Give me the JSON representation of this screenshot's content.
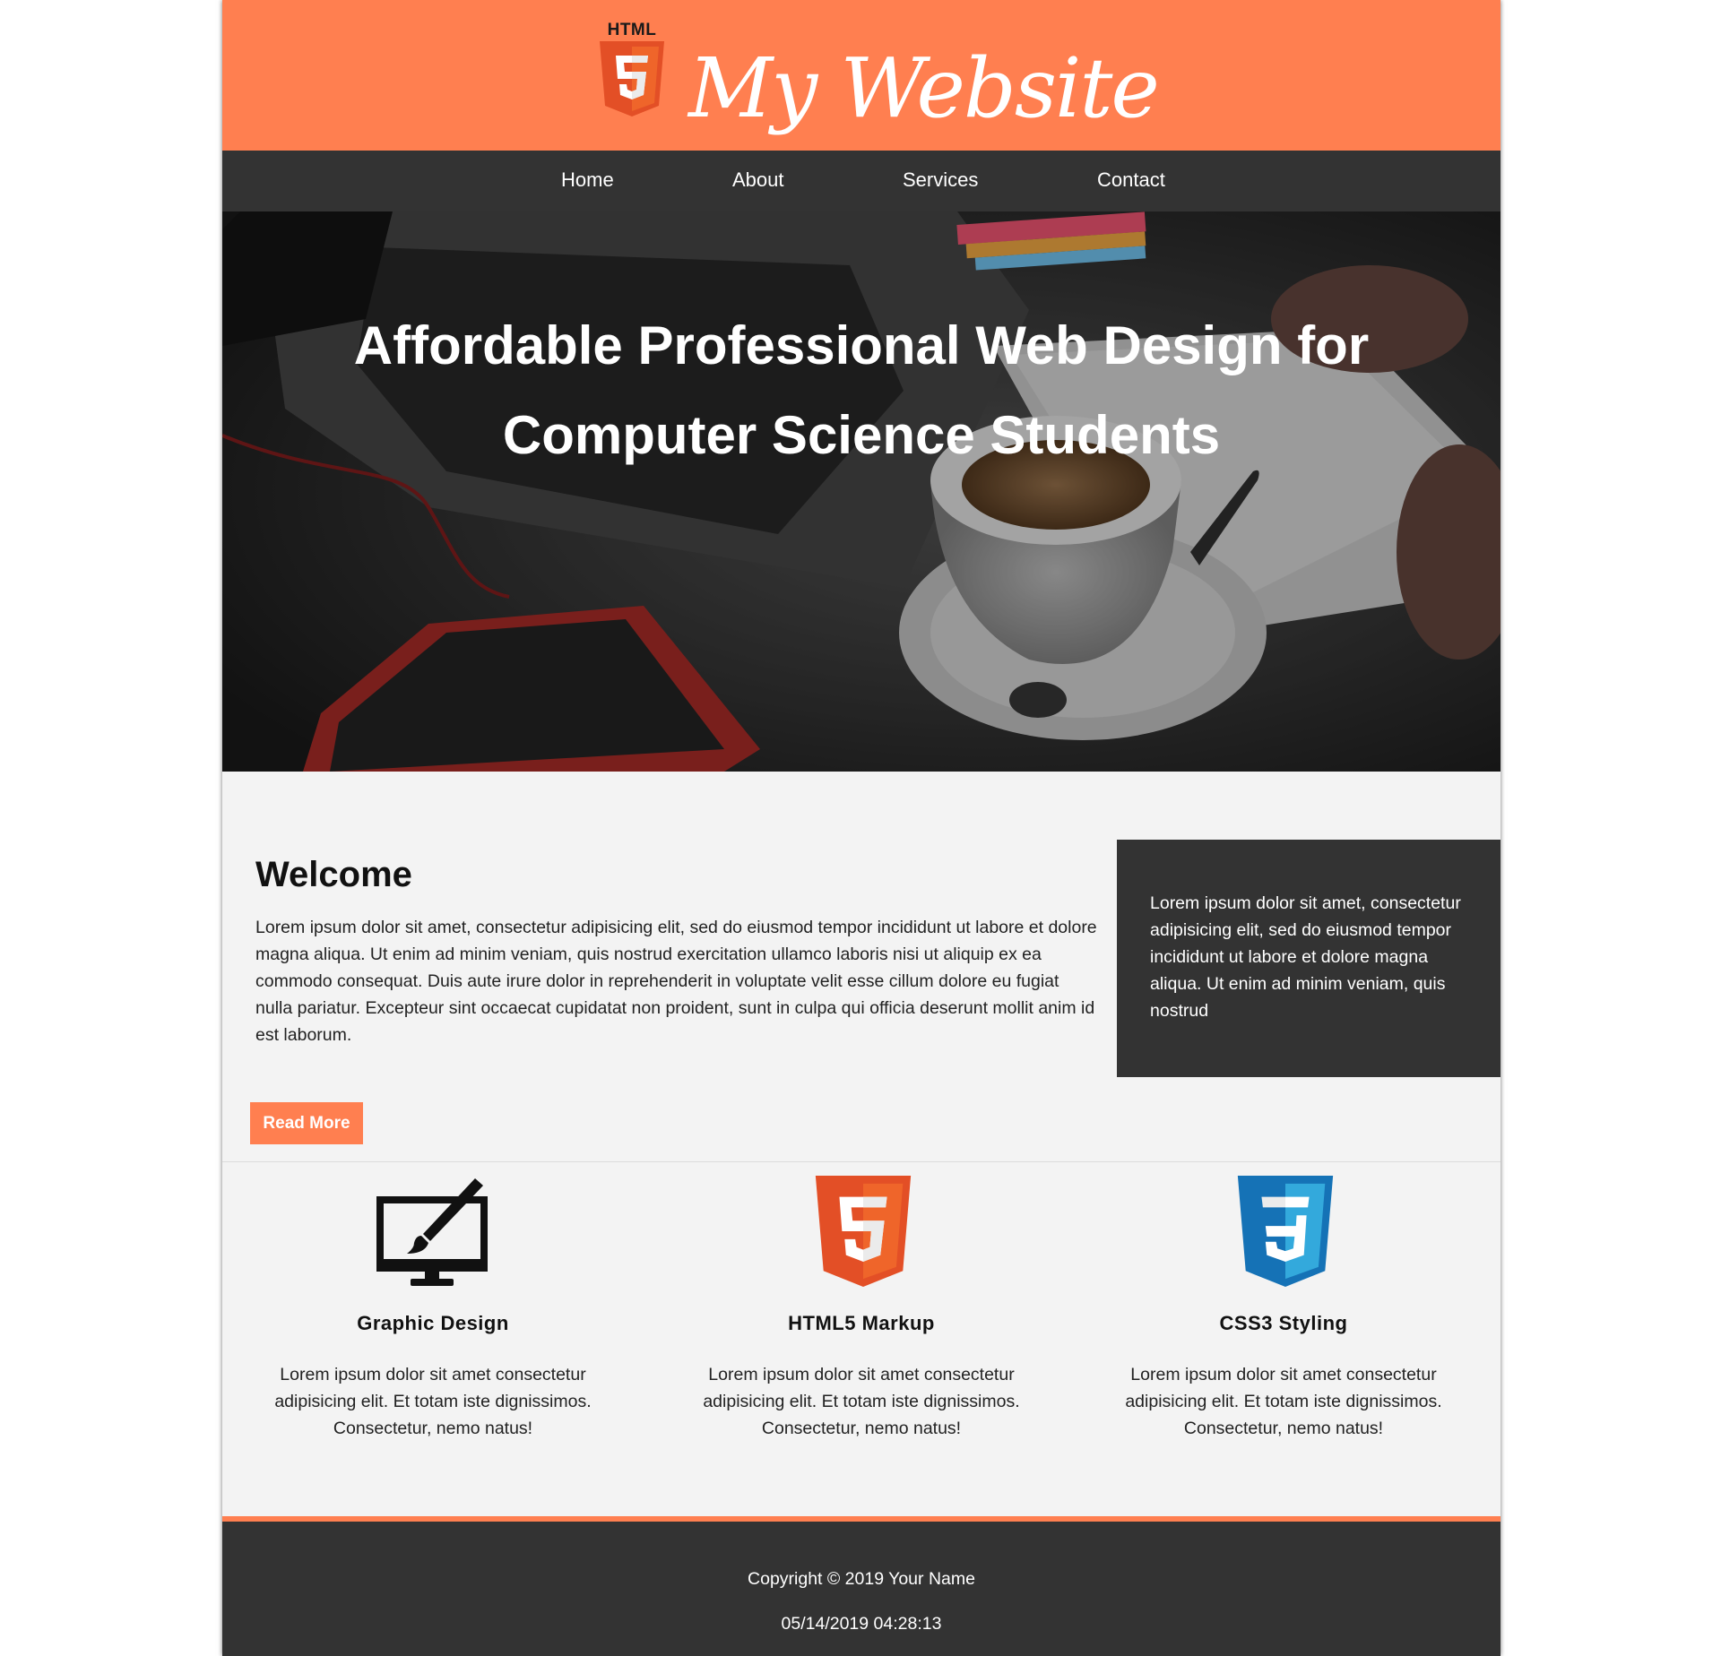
{
  "header": {
    "logo_caption": "HTML",
    "logo_digit": "5",
    "site_title": "My Website"
  },
  "nav": {
    "items": [
      {
        "label": "Home"
      },
      {
        "label": "About"
      },
      {
        "label": "Services"
      },
      {
        "label": "Contact"
      }
    ]
  },
  "hero": {
    "title_line1": "Affordable Professional Web Design for",
    "title_line2": "Computer Science Students"
  },
  "main": {
    "welcome_title": "Welcome",
    "welcome_text": "Lorem ipsum dolor sit amet, consectetur adipisicing elit, sed do eiusmod tempor incididunt ut labore et dolore magna aliqua. Ut enim ad minim veniam, quis nostrud exercitation ullamco laboris nisi ut aliquip ex ea commodo consequat. Duis aute irure dolor in reprehenderit in voluptate velit esse cillum dolore eu fugiat nulla pariatur. Excepteur sint occaecat cupidatat non proident, sunt in culpa qui officia deserunt mollit anim id est laborum.",
    "read_more_label": "Read More"
  },
  "sidebar": {
    "text": "Lorem ipsum dolor sit amet, consectetur adipisicing elit, sed do eiusmod tempor incididunt ut labore et dolore magna aliqua. Ut enim ad minim veniam, quis nostrud"
  },
  "services": [
    {
      "icon": "monitor-brush-icon",
      "title": "Graphic Design",
      "text": "Lorem ipsum dolor sit amet consectetur adipisicing elit. Et totam iste dignissimos. Consectetur, nemo natus!"
    },
    {
      "icon": "html5-icon",
      "title": "HTML5 Markup",
      "text": "Lorem ipsum dolor sit amet consectetur adipisicing elit. Et totam iste dignissimos. Consectetur, nemo natus!"
    },
    {
      "icon": "css3-icon",
      "title": "CSS3 Styling",
      "text": "Lorem ipsum dolor sit amet consectetur adipisicing elit. Et totam iste dignissimos. Consectetur, nemo natus!"
    }
  ],
  "footer": {
    "copyright": "Copyright © 2019 Your Name",
    "datetime": "05/14/2019 04:28:13"
  },
  "colors": {
    "accent": "#ff7f50",
    "dark": "#333333",
    "page_bg": "#f3f3f3"
  }
}
